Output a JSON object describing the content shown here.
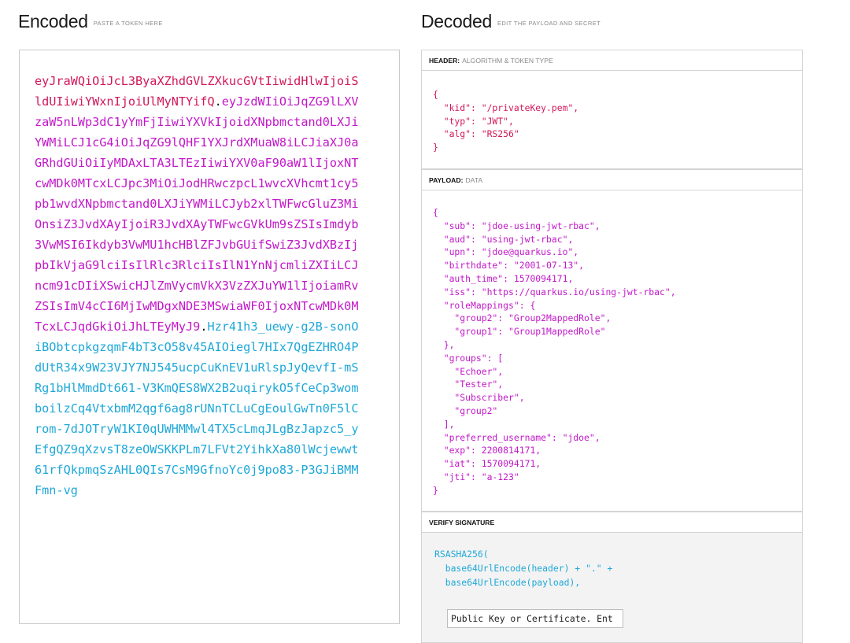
{
  "encoded": {
    "title": "Encoded",
    "subtitle": "PASTE A TOKEN HERE",
    "token": {
      "header": "eyJraWQiOiJcL3ByaXZhdGVLZXkucGVtIiwidHlwIjoiSldUIiwiYWxnIjoiUlMyNTYifQ",
      "payload": "eyJzdWIiOiJqZG9lLXVzaW5nLWp3dC1yYmFjIiwiYXVkIjoidXNpbmctand0LXJiYWMiLCJ1cG4iOiJqZG9lQHF1YXJrdXMuaW8iLCJiaXJ0aGRhdGUiOiIyMDAxLTA3LTEzIiwiYXV0aF90aW1lIjoxNTcwMDk0MTcxLCJpc3MiOiJodHRwczpcL1wvcXVhcmt1cy5pb1wvdXNpbmctand0LXJiYWMiLCJyb2xlTWFwcGluZ3MiOnsiZ3JvdXAyIjoiR3JvdXAyTWFwcGVkUm9sZSIsImdyb3VwMSI6Ikdyb3VwMU1hcHBlZFJvbGUifSwiZ3JvdXBzIjpbIkVjaG9lciIsIlRlc3RlciIsIlN1YnNjcmliZXIiLCJncm91cDIiXSwicHJlZmVycmVkX3VzZXJuYW1lIjoiamRvZSIsImV4cCI6MjIwMDgxNDE3MSwiaWF0IjoxNTcwMDk0MTcxLCJqdGkiOiJhLTEyMyJ9",
      "signature": "Hzr41h3_uewy-g2B-sonOiBObtcpkgzqmF4bT3cO58v45AIOiegl7HIx7QgEZHRO4PdUtR34x9W23VJY7NJ545ucpCuKnEV1uRlspJyQevfI-mSRg1bHlMmdDt661-V3KmQES8WX2B2uqirykO5fCeCp3womboilzCq4VtxbmM2qgf6ag8rUNnTCLuCgEoulGwTn0F5lCrom-7dJOTryW1KI0qUWHMMwl4TX5cLmqJLgBzJapzc5_yEfgQZ9qXzvsT8zeOWSKKPLm7LFVt2YihkXa80lWcjewwt61rfQkpmqSzAHL0QIs7CsM9GfnoYc0j9po83-P3GJiBMMFmn-vg",
      "dot": "."
    }
  },
  "decoded": {
    "title": "Decoded",
    "subtitle": "EDIT THE PAYLOAD AND SECRET",
    "header_label": "HEADER:",
    "header_sub": "ALGORITHM & TOKEN TYPE",
    "header_json": "{\n  \"kid\": \"/privateKey.pem\",\n  \"typ\": \"JWT\",\n  \"alg\": \"RS256\"\n}",
    "payload_label": "PAYLOAD:",
    "payload_sub": "DATA",
    "payload_json": "{\n  \"sub\": \"jdoe-using-jwt-rbac\",\n  \"aud\": \"using-jwt-rbac\",\n  \"upn\": \"jdoe@quarkus.io\",\n  \"birthdate\": \"2001-07-13\",\n  \"auth_time\": 1570094171,\n  \"iss\": \"https://quarkus.io/using-jwt-rbac\",\n  \"roleMappings\": {\n    \"group2\": \"Group2MappedRole\",\n    \"group1\": \"Group1MappedRole\"\n  },\n  \"groups\": [\n    \"Echoer\",\n    \"Tester\",\n    \"Subscriber\",\n    \"group2\"\n  ],\n  \"preferred_username\": \"jdoe\",\n  \"exp\": 2200814171,\n  \"iat\": 1570094171,\n  \"jti\": \"a-123\"\n}",
    "verify_label": "VERIFY SIGNATURE",
    "verify_code": "RSASHA256(\n  base64UrlEncode(header) + \".\" +\n  base64UrlEncode(payload),",
    "key_placeholder": "Public Key or Certificate. Ent"
  }
}
